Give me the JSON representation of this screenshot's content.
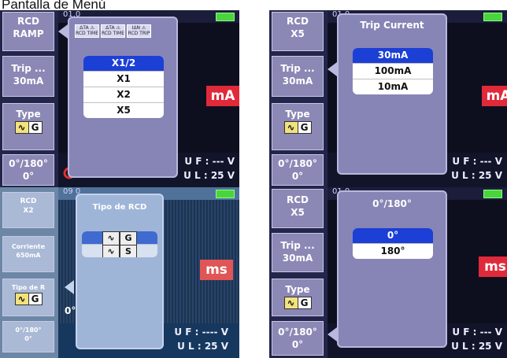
{
  "caption": "Pantalla de Menú",
  "colors": {
    "accent": "#1c3fd6",
    "unit_badge": "#e02a3a",
    "sidebar_button": "#8b88b5",
    "battery": "#4bd43b"
  },
  "panels": {
    "p1": {
      "sidebar": {
        "b1_l1": "RCD",
        "b1_l2": "RAMP",
        "b2_l1": "Trip ...",
        "b2_l2": "30mA",
        "b3_l1": "Type",
        "b3_sym": "∿",
        "b3_letter": "G",
        "b4_l1": "0°/180°",
        "b4_l2": "0°"
      },
      "date": "01.0",
      "icons": [
        "ΔTA ⚠ RCD TIME",
        "ΔTA ⚠ RCD TIME",
        "IΔN ⚠ RCD TRIP"
      ],
      "options": [
        "X1/2",
        "X1",
        "X2",
        "X5"
      ],
      "unit": "mA",
      "uf": "U F : --- V",
      "ul": "U L : 25 V"
    },
    "p2": {
      "sidebar": {
        "b1_l1": "RCD",
        "b1_l2": "X5",
        "b2_l1": "Trip ...",
        "b2_l2": "30mA",
        "b3_l1": "Type",
        "b3_sym": "∿",
        "b3_letter": "G",
        "b4_l1": "0°/180°",
        "b4_l2": "0°"
      },
      "date": "01.0",
      "title": "Trip Current",
      "options": [
        "30mA",
        "100mA",
        "10mA"
      ],
      "unit": "mA",
      "uf": "U F : --- V",
      "ul": "U L : 25 V"
    },
    "p3": {
      "sidebar": {
        "b1_l1": "RCD",
        "b1_l2": "X2",
        "b2_l1": "Corriente",
        "b2_l2": "650mA",
        "b3_l1": "Tipo de R",
        "b3_sym": "∿",
        "b3_letter": "G",
        "b4_l1": "0°/180°",
        "b4_l2": "0°"
      },
      "date": "09 0",
      "title": "Tipo de RCD",
      "options": [
        {
          "sym": "∿",
          "letter": "G"
        },
        {
          "sym": "∿",
          "letter": "S"
        }
      ],
      "unit": "ms",
      "side_text": "0°",
      "uf": "U F : ---- V",
      "ul": "U L : 25 V"
    },
    "p4": {
      "sidebar": {
        "b1_l1": "RCD",
        "b1_l2": "X5",
        "b2_l1": "Trip ...",
        "b2_l2": "30mA",
        "b3_l1": "Type",
        "b3_sym": "∿",
        "b3_letter": "G",
        "b4_l1": "0°/180°",
        "b4_l2": "0°"
      },
      "date": "01.0",
      "title": "0°/180°",
      "options": [
        "0°",
        "180°"
      ],
      "unit": "ms",
      "uf": "U F : --- V",
      "ul": "U L : 25 V"
    }
  }
}
